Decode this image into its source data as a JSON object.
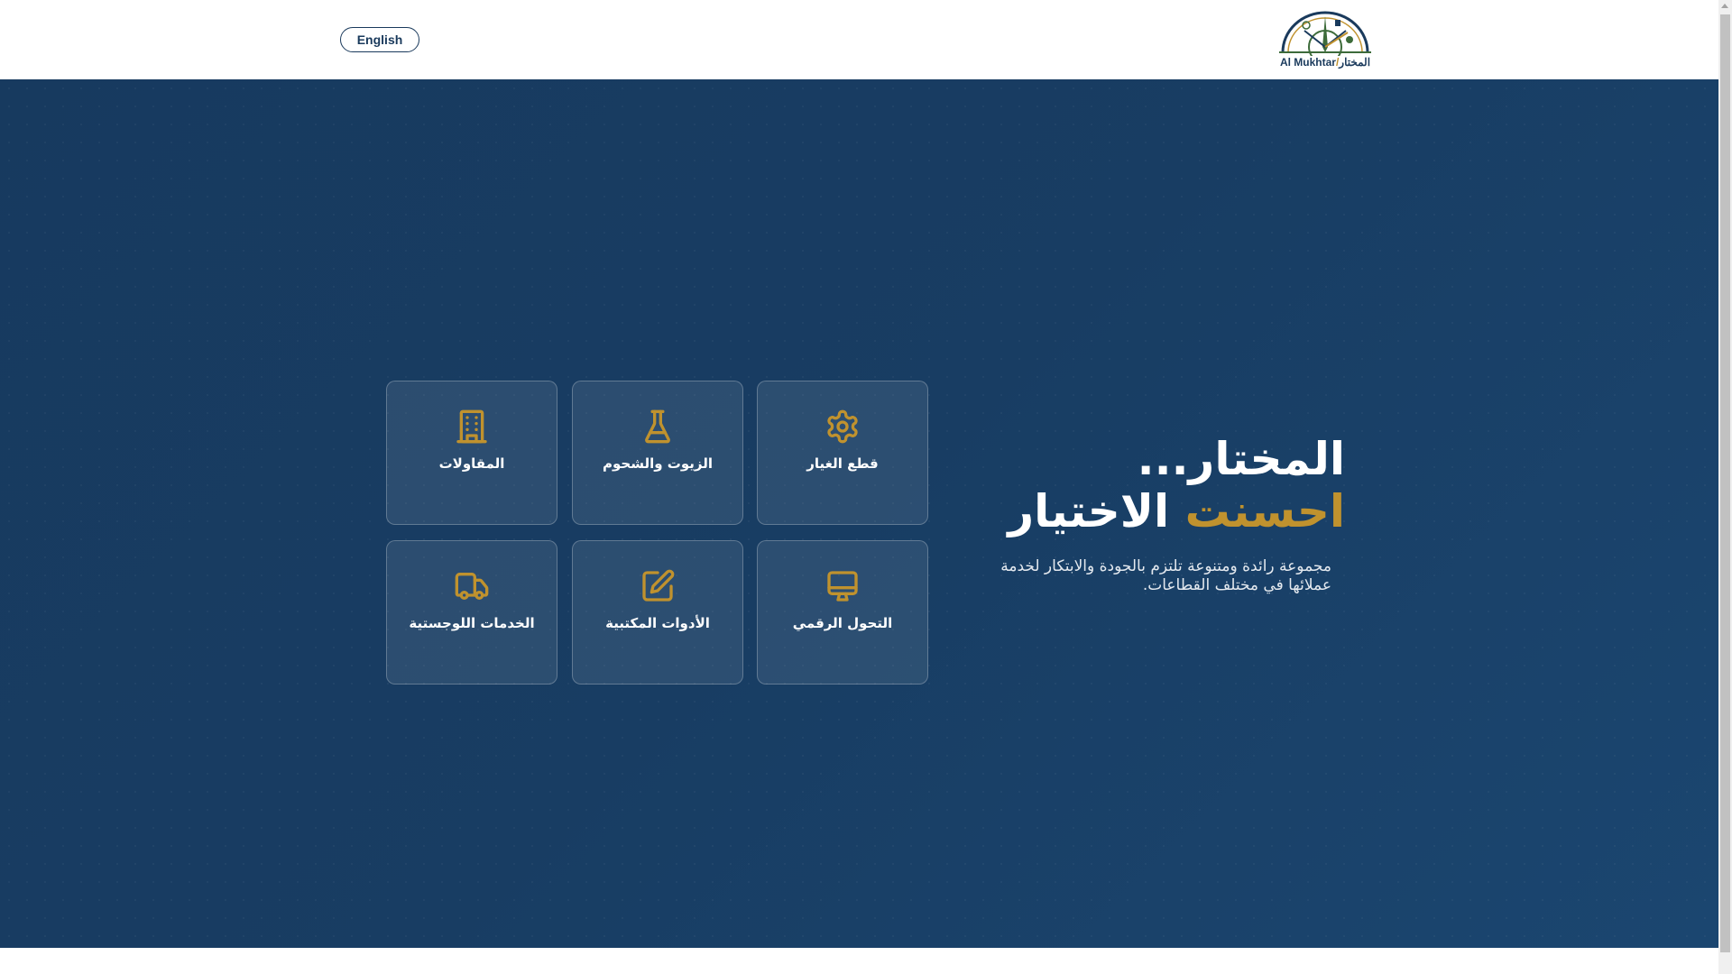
{
  "header": {
    "language_button": "English",
    "logo": {
      "text_en": "Al Mukhtar",
      "separator": "/",
      "text_ar": "المختار"
    }
  },
  "hero": {
    "title_line1": "المختار...",
    "title_line2_gold": "احسنت",
    "title_line2_white": "الاختيار",
    "description": "مجموعة رائدة ومتنوعة تلتزم بالجودة والابتكار لخدمة عملائها في مختلف القطاعات."
  },
  "cards": [
    {
      "label": "قطع الغيار",
      "icon": "gear-icon"
    },
    {
      "label": "الزيوت والشحوم",
      "icon": "flask-icon"
    },
    {
      "label": "المقاولات",
      "icon": "building-icon"
    },
    {
      "label": "التحول الرقمي",
      "icon": "monitor-icon"
    },
    {
      "label": "الأدوات المكتبية",
      "icon": "pencil-square-icon"
    },
    {
      "label": "الخدمات اللوجستية",
      "icon": "truck-icon"
    }
  ],
  "colors": {
    "navy": "#173a5f",
    "gold": "#c0922e"
  }
}
